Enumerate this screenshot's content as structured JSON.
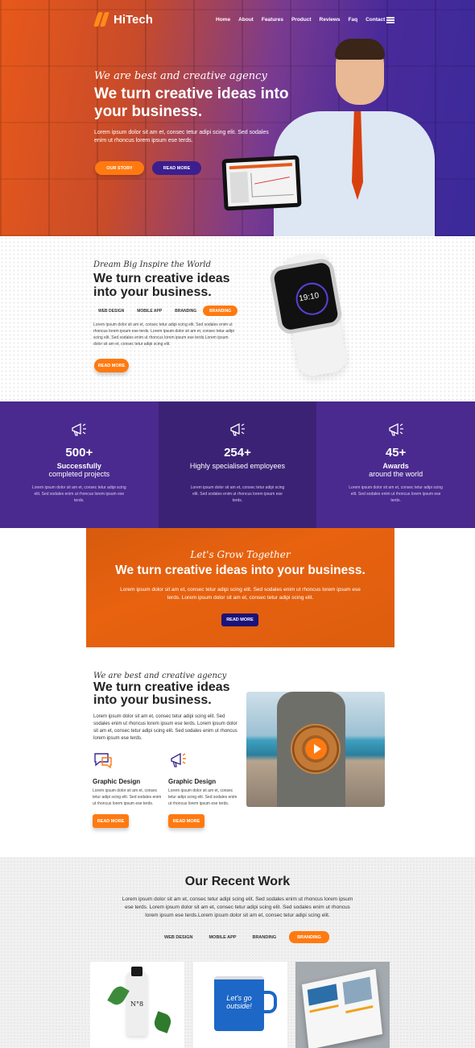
{
  "brand": {
    "name": "HiTech",
    "accent": "#ff7a10",
    "purple": "#4a2a8e"
  },
  "nav": {
    "items": [
      "Home",
      "About",
      "Features",
      "Product",
      "Reviews",
      "Faq",
      "Contact"
    ]
  },
  "hero": {
    "tagline": "We are best and creative agency",
    "title": "We  turn creative ideas into your business.",
    "text": "Lorem ipsum dolor sit am et, consec tetur adipi scing elit. Sed sodales enim ut rhoncus lorem ipsum ese terds.",
    "btn_story": "OUR STORY",
    "btn_read": "READ MORE"
  },
  "feature": {
    "tagline": "Dream Big Inspire the World",
    "title": "We  turn creative ideas into your business.",
    "tabs": [
      "WEB DESIGN",
      "MOBILE APP",
      "BRANDING",
      "BRANDING"
    ],
    "text": "Lorem ipsum dolor sit am et, consec tetur adipi scing elit. Sed sodales enim ut rhoncus lorem ipsum ese terds. Lorem ipsum dolor sit am et, consec tetur adipi scing elit. Sed sodales enim ut rhoncus lorem ipsum ese terds.Lorem ipsum dolor sit am et, consec tetur adipi scing elit.",
    "btn_read": "READ MORE",
    "watch_time": "19:10"
  },
  "stats": [
    {
      "number": "500+",
      "label_bold": "Successfully",
      "label": "completed projects",
      "text": "Lorem ipsum dolor sit am et, consec tetur adipi scing elit. Sed sodales enim ut rhoncus lorem ipsum ese terds."
    },
    {
      "number": "254+",
      "label_bold": "Highly",
      "label": "specialised employees",
      "text": "Lorem ipsum dolor sit am et, consec tetur adipi scing elit. Sed sodales enim ut rhoncus lorem ipsum ese terds."
    },
    {
      "number": "45+",
      "label_bold": "Awards",
      "label": "around the world",
      "text": "Lorem ipsum dolor sit am et, consec tetur adipi scing elit. Sed sodales enim ut rhoncus lorem ipsum ese terds."
    }
  ],
  "grow": {
    "tagline": "Let's Grow Together",
    "title": "We  turn creative ideas into your business.",
    "text": "Lorem ipsum dolor sit am et, consec tetur adipi scing elit. Sed sodales enim ut rhoncus lorem ipsum ese terds. Lorem ipsum dolor sit am et, consec tetur adipi scing elit.",
    "btn_read": "READ MORE"
  },
  "about": {
    "tagline": "We are best and creative agency",
    "title": "We  turn creative ideas into your business.",
    "text": "Lorem ipsum dolor sit am et, consec tetur adipi scing elit. Sed sodales enim ut rhoncus lorem ipsum ese terds. Lorem ipsum dolor sit am et, consec tetur adipi scing elit. Sed sodales enim ut rhoncus lorem ipsum ese terds.",
    "features": [
      {
        "title": "Graphic Design",
        "text": "Lorem ipsum dolor sit am et, consec tetur adipi scing elit. Sed sodales enim ut rhoncus lorem ipsum ese terds.",
        "btn": "READ MORE"
      },
      {
        "title": "Graphic Design",
        "text": "Lorem ipsum dolor sit am et, consec tetur adipi scing elit. Sed sodales enim ut rhoncus lorem ipsum ese terds.",
        "btn": "READ MORE"
      }
    ]
  },
  "work": {
    "title": "Our Recent Work",
    "text": "Lorem ipsum dolor sit am et, consec tetur adipi scing elit. Sed sodales enim ut rhoncus lorem ipsum ese terds. Lorem ipsum dolor sit am et, consec tetur adipi scing elit. Sed sodales enim ut rhoncus lorem ipsum ese terds.Lorem ipsum dolor sit am et, consec tetur adipi scing elit.",
    "tabs": [
      "WEB DESIGN",
      "MOBILE APP",
      "BRANDING",
      "BRANDING"
    ],
    "bottle_label": "N°8",
    "mug_text": "Let's go outside!"
  }
}
